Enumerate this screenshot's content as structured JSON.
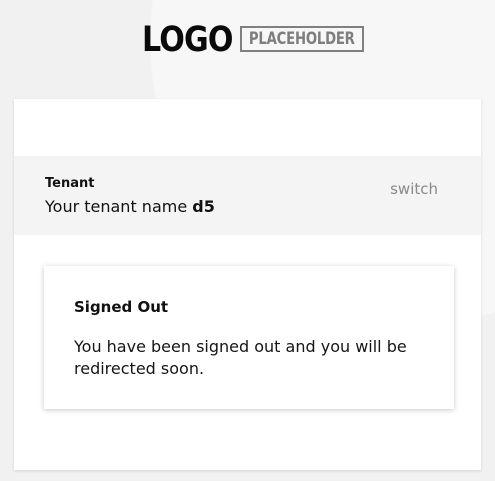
{
  "logo": {
    "word": "LOGO",
    "boxed": "PLACEHOLDER"
  },
  "tenant": {
    "label": "Tenant",
    "name_prefix": "Your tenant name",
    "name_value": "d5",
    "switch_label": "switch"
  },
  "notice": {
    "title": "Signed Out",
    "message": "You have been signed out and you will be redirected soon."
  }
}
